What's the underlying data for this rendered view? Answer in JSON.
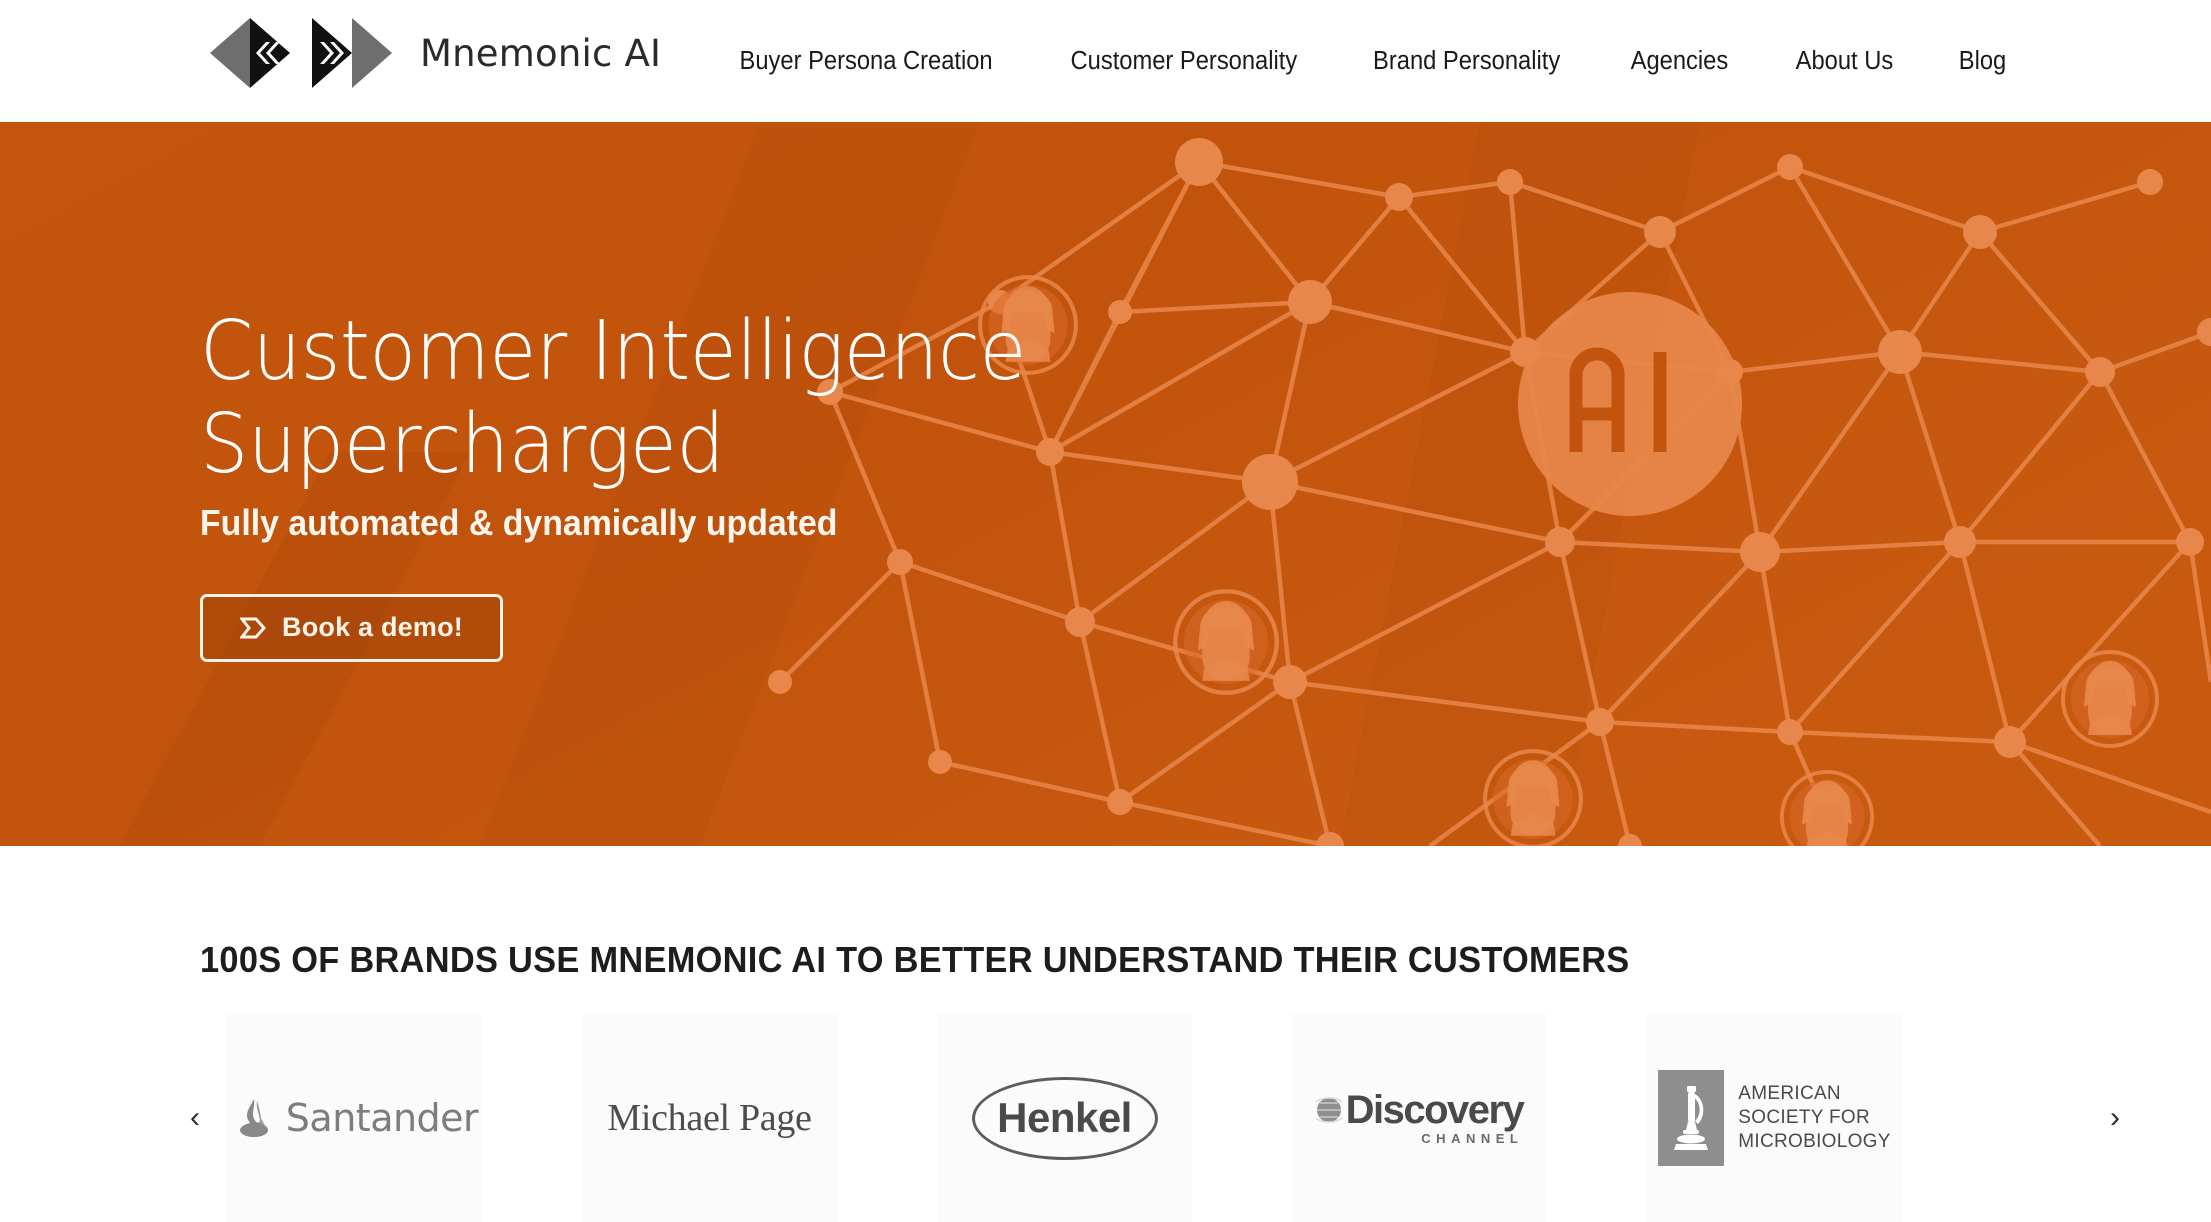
{
  "header": {
    "logo": {
      "mark_name": "mnemonic-chevrons-logo",
      "text": "Mnemonic AI"
    },
    "nav": [
      {
        "label": "Buyer Persona Creation",
        "name": "nav-item-buyer-persona-creation"
      },
      {
        "label": "Customer Personality",
        "name": "nav-item-customer-personality"
      },
      {
        "label": "Brand Personality",
        "name": "nav-item-brand-personality"
      },
      {
        "label": "Agencies",
        "name": "nav-item-agencies"
      },
      {
        "label": "About Us",
        "name": "nav-item-about-us"
      },
      {
        "label": "Blog",
        "name": "nav-item-blog"
      }
    ]
  },
  "hero": {
    "title_line1": "Customer Intelligence",
    "title_line2": "Supercharged",
    "subtitle": "Fully automated & dynamically updated",
    "cta_label": "Book a demo!",
    "cta_icon": "arrow-pennant-icon",
    "badge_text": "AI",
    "background_color": "#c2540d",
    "network_color": "#e07a3c"
  },
  "brands": {
    "title": "100S OF BRANDS USE MNEMONIC AI TO BETTER UNDERSTAND THEIR CUSTOMERS",
    "prev_arrow": "‹",
    "next_arrow": "›",
    "logos": [
      {
        "name": "brand-logo-santander",
        "text": "Santander"
      },
      {
        "name": "brand-logo-michael-page",
        "text": "Michael Page"
      },
      {
        "name": "brand-logo-henkel",
        "text": "Henkel"
      },
      {
        "name": "brand-logo-discovery-channel",
        "text": "Discovery",
        "subtext": "CHANNEL"
      },
      {
        "name": "brand-logo-american-society-for-microbiology",
        "line1": "AMERICAN",
        "line2": "SOCIETY FOR",
        "line3": "MICROBIOLOGY"
      }
    ]
  }
}
